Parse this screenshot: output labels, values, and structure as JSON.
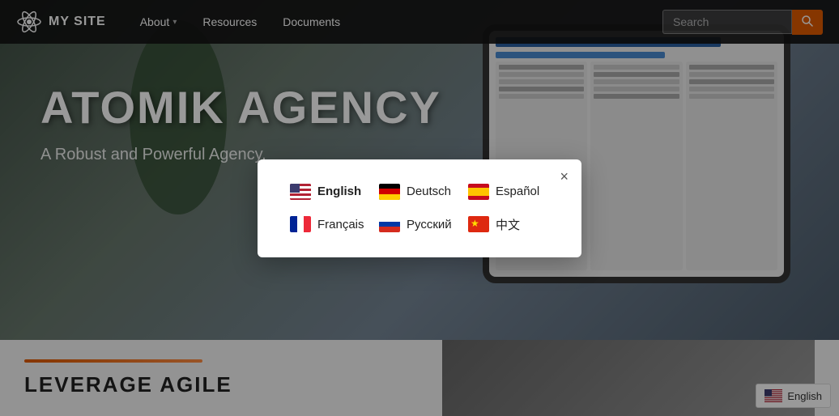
{
  "site": {
    "logo_text": "MY SITE",
    "logo_icon": "atom"
  },
  "navbar": {
    "about_label": "About",
    "resources_label": "Resources",
    "documents_label": "Documents",
    "search_placeholder": "Search"
  },
  "hero": {
    "title": "ATOMIK AGENCY",
    "subtitle": "A Robust and Powerful Agency."
  },
  "bottom": {
    "title": "LEVERAGE AGILE"
  },
  "language_modal": {
    "close_label": "×",
    "languages": [
      {
        "code": "en",
        "label": "English",
        "flag": "us"
      },
      {
        "code": "de",
        "label": "Deutsch",
        "flag": "de"
      },
      {
        "code": "es",
        "label": "Español",
        "flag": "es"
      },
      {
        "code": "fr",
        "label": "Français",
        "flag": "fr"
      },
      {
        "code": "ru",
        "label": "Русский",
        "flag": "ru"
      },
      {
        "code": "zh",
        "label": "中文",
        "flag": "cn"
      }
    ]
  },
  "footer_lang": {
    "label": "English"
  }
}
